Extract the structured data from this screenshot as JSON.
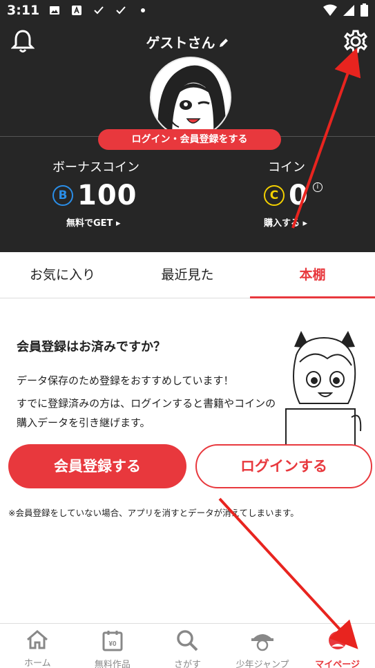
{
  "status_bar": {
    "time": "3:11"
  },
  "header": {
    "username": "ゲストさん",
    "login_cta": "ログイン・会員登録をする",
    "bonus": {
      "label": "ボーナスコイン",
      "symbol": "B",
      "amount": "100",
      "link": "無料でGET ▸"
    },
    "coin": {
      "label": "コイン",
      "symbol": "C",
      "amount": "0",
      "info": "i",
      "link": "購入する ▸"
    }
  },
  "tabs": [
    {
      "label": "お気に入り",
      "active": false
    },
    {
      "label": "最近見た",
      "active": false
    },
    {
      "label": "本棚",
      "active": true
    }
  ],
  "registration": {
    "title": "会員登録はお済みですか？",
    "desc1": "データ保存のため登録をおすすめしています！",
    "desc2": "すでに登録済みの方は、ログインすると書籍やコインの購入データを引き継げます。",
    "register_button": "会員登録する",
    "login_button": "ログインする",
    "notice": "※会員登録をしていない場合、アプリを消すとデータが消えてしまいます。"
  },
  "bottom_nav": [
    {
      "label": "ホーム",
      "icon": "home-icon"
    },
    {
      "label": "無料作品",
      "icon": "calendar-yen-icon",
      "badge": "¥0"
    },
    {
      "label": "さがす",
      "icon": "search-icon"
    },
    {
      "label": "少年ジャンプ",
      "icon": "jump-pirate-icon"
    },
    {
      "label": "マイページ",
      "icon": "mypage-icon",
      "active": true
    }
  ],
  "colors": {
    "accent": "#e8383d",
    "header_bg": "#262626",
    "bonus_coin": "#2a8ee8",
    "coin": "#f3d000"
  }
}
